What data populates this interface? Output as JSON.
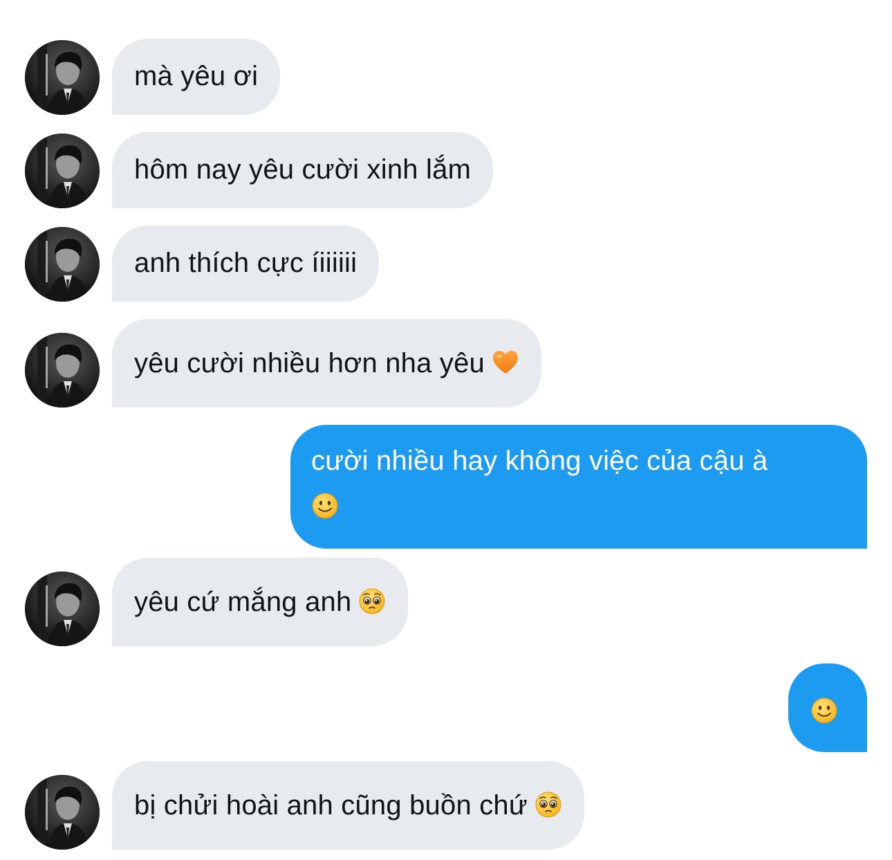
{
  "conversation": {
    "messages": [
      {
        "sender": "other",
        "text": "mà yêu ơi"
      },
      {
        "sender": "other",
        "text": "hôm nay yêu cười xinh lắm"
      },
      {
        "sender": "other",
        "text": "anh thích cực íiiiiii"
      },
      {
        "sender": "other",
        "text": "yêu cười nhiều hơn nha yêu",
        "emoji": "orange-heart-icon"
      },
      {
        "sender": "me",
        "text": "cười nhiều hay không việc của cậu à",
        "emoji": "slightly-smiling-face-icon"
      },
      {
        "sender": "other",
        "text": "yêu cứ mắng anh",
        "emoji": "pleading-face-icon"
      },
      {
        "sender": "me",
        "text": "",
        "emoji": "slightly-smiling-face-icon"
      },
      {
        "sender": "other",
        "text": "bị chửi hoài anh cũng buồn chứ",
        "emoji": "pleading-face-icon"
      }
    ]
  },
  "colors": {
    "incoming_bubble": "#e7ebef",
    "outgoing_bubble": "#1d9bf0",
    "incoming_text": "#0f1419",
    "outgoing_text": "#ffffff"
  }
}
